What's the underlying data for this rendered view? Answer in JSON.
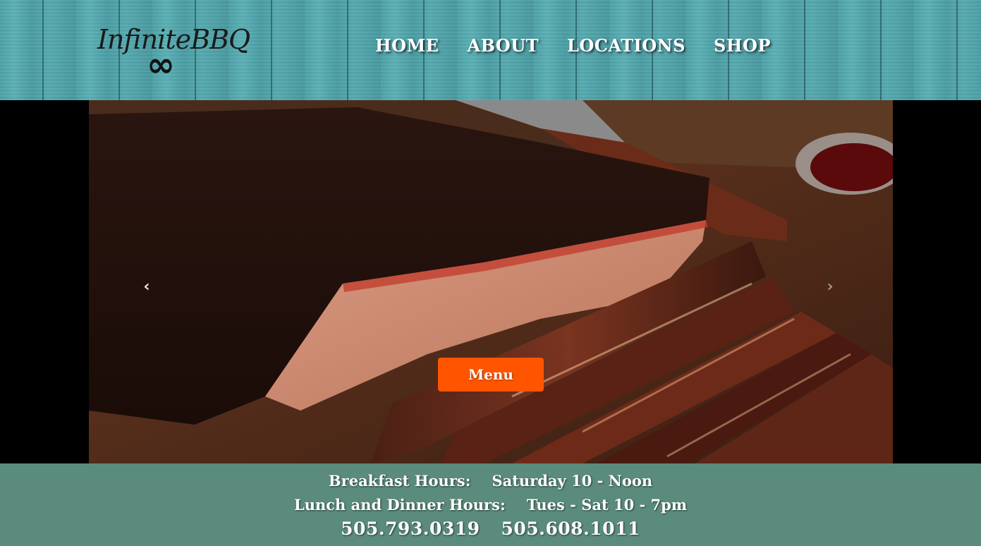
{
  "brand": {
    "logo_text": "InfiniteBBQ",
    "logo_symbol": "∞"
  },
  "nav": {
    "items": [
      {
        "label": "HOME"
      },
      {
        "label": "ABOUT"
      },
      {
        "label": "LOCATIONS"
      },
      {
        "label": "SHOP"
      }
    ]
  },
  "carousel": {
    "prev_icon": "‹",
    "next_icon": "›",
    "menu_button_label": "Menu"
  },
  "hours": {
    "breakfast_label": "Breakfast Hours:",
    "breakfast_value": "Saturday 10 - Noon",
    "lunch_label": "Lunch and Dinner Hours:",
    "lunch_value": "Tues - Sat 10 - 7pm",
    "phone_1": "505.793.0319",
    "phone_2": "505.608.1011"
  },
  "colors": {
    "accent": "#ff5500",
    "info_bar": "#5a8b7c",
    "header_wood": "#4fa3a9"
  }
}
